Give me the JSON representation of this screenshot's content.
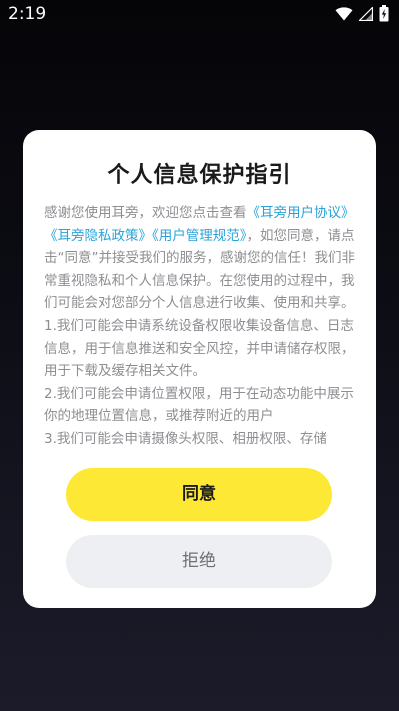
{
  "status_bar": {
    "time": "2:19",
    "icons": [
      "wifi-icon",
      "signal-icon",
      "battery-charging-icon"
    ]
  },
  "dialog": {
    "title": "个人信息保护指引",
    "body": {
      "intro_prefix": "感谢您使用耳旁，欢迎您点击查看",
      "link_user_agreement": "《耳旁用户协议》",
      "link_privacy_policy": "《耳旁隐私政策》",
      "link_user_rules": "《用户管理规范》",
      "intro_suffix": "，如您同意，请点击“同意”并接受我们的服务，感谢您的信任！我们非常重视隐私和个人信息保护。在您使用的过程中，我们可能会对您部分个人信息进行收集、使用和共享。",
      "item_1": "1.我们可能会申请系统设备权限收集设备信息、日志信息，用于信息推送和安全风控，并申请储存权限，用于下载及缓存相关文件。",
      "item_2": "2.我们可能会申请位置权限，用于在动态功能中展示你的地理位置信息，或推荐附近的用户",
      "item_3": "3.我们可能会申请摄像头权限、相册权限、存储"
    },
    "agree_label": "同意",
    "reject_label": "拒绝"
  },
  "colors": {
    "agree_button": "#fde935",
    "reject_button": "#eeeff3",
    "link": "#29a3d9",
    "body_text": "#8e8e93"
  }
}
